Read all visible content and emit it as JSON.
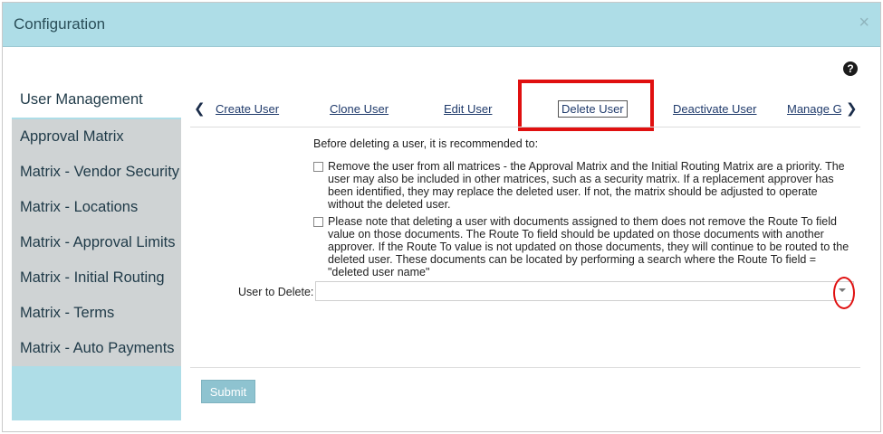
{
  "dialog": {
    "title": "Configuration",
    "close_label": "×"
  },
  "help": {
    "label": "?"
  },
  "sidebar": {
    "items": [
      {
        "label": "User Management"
      },
      {
        "label": "Approval Matrix"
      },
      {
        "label": "Matrix - Vendor Security"
      },
      {
        "label": "Matrix - Locations"
      },
      {
        "label": "Matrix - Approval Limits"
      },
      {
        "label": "Matrix - Initial Routing"
      },
      {
        "label": "Matrix - Terms"
      },
      {
        "label": "Matrix - Auto Payments"
      }
    ],
    "active_index": 0
  },
  "tabs": {
    "prev_label": "❮",
    "next_label": "❯",
    "items": [
      {
        "label": "Create User"
      },
      {
        "label": "Clone User"
      },
      {
        "label": "Edit User"
      },
      {
        "label": "Delete User"
      },
      {
        "label": "Deactivate User"
      },
      {
        "label": "Manage Gr"
      }
    ],
    "active_index": 3
  },
  "delete_user": {
    "intro": "Before deleting a user, it is recommended to:",
    "notes": [
      {
        "text": "Remove the user from all matrices - the Approval Matrix and the Initial Routing Matrix are a priority. The user may also be included in other matrices, such as a security matrix. If a replacement approver has been identified, they may replace the deleted user. If not, the matrix should be adjusted to operate without the deleted user."
      },
      {
        "text": "Please note that deleting a user with documents assigned to them does not remove the Route To field value on those documents. The Route To field should be updated on those documents with another approver. If the Route To value is not updated on those documents, they will continue to be routed to the deleted user. These documents can be located by performing a search where the Route To field = \"deleted user name\""
      }
    ],
    "field_label": "User to Delete:",
    "field_value": "",
    "submit_label": "Submit"
  },
  "colors": {
    "header_bg": "#aedde7",
    "sidebar_bg": "#aedde7",
    "sidebar_item_bg": "#cfd3d4",
    "highlight": "#e01010",
    "submit_bg": "#8ec3d0"
  }
}
